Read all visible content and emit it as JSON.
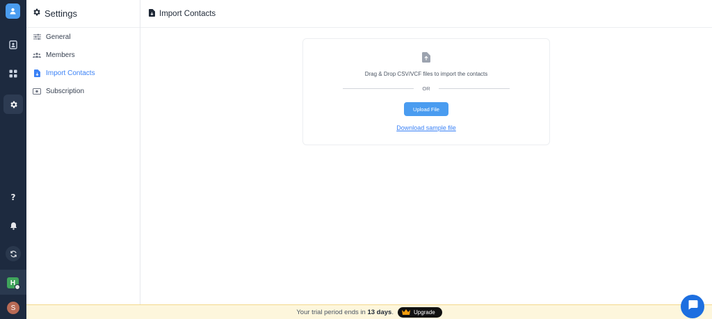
{
  "rail": {
    "icons": [
      "contacts-logo-icon",
      "address-book-icon",
      "apps-grid-icon",
      "gear-icon",
      "help-icon",
      "bell-icon",
      "sync-icon",
      "workspace-icon",
      "avatar"
    ],
    "workspace_letter": "H",
    "avatar_letter": "S"
  },
  "sidebar": {
    "title": "Settings",
    "items": [
      {
        "label": "General",
        "icon": "sliders-icon",
        "active": false
      },
      {
        "label": "Members",
        "icon": "users-icon",
        "active": false
      },
      {
        "label": "Import Contacts",
        "icon": "file-import-icon",
        "active": true
      },
      {
        "label": "Subscription",
        "icon": "money-icon",
        "active": false
      }
    ]
  },
  "main": {
    "title": "Import Contacts",
    "dropzone": {
      "instruction": "Drag & Drop CSV/VCF files to import the contacts",
      "or_label": "OR",
      "upload_label": "Upload File",
      "sample_link": "Download sample file"
    }
  },
  "trial": {
    "prefix": "Your trial period ends in",
    "days": "13 days",
    "suffix": ".",
    "upgrade_label": "Upgrade"
  },
  "colors": {
    "rail_bg": "#1d2a3f",
    "accent": "#4a9cf0",
    "link": "#3b82f6",
    "banner_bg": "#fdf6dc",
    "fab": "#1d6fe0"
  }
}
